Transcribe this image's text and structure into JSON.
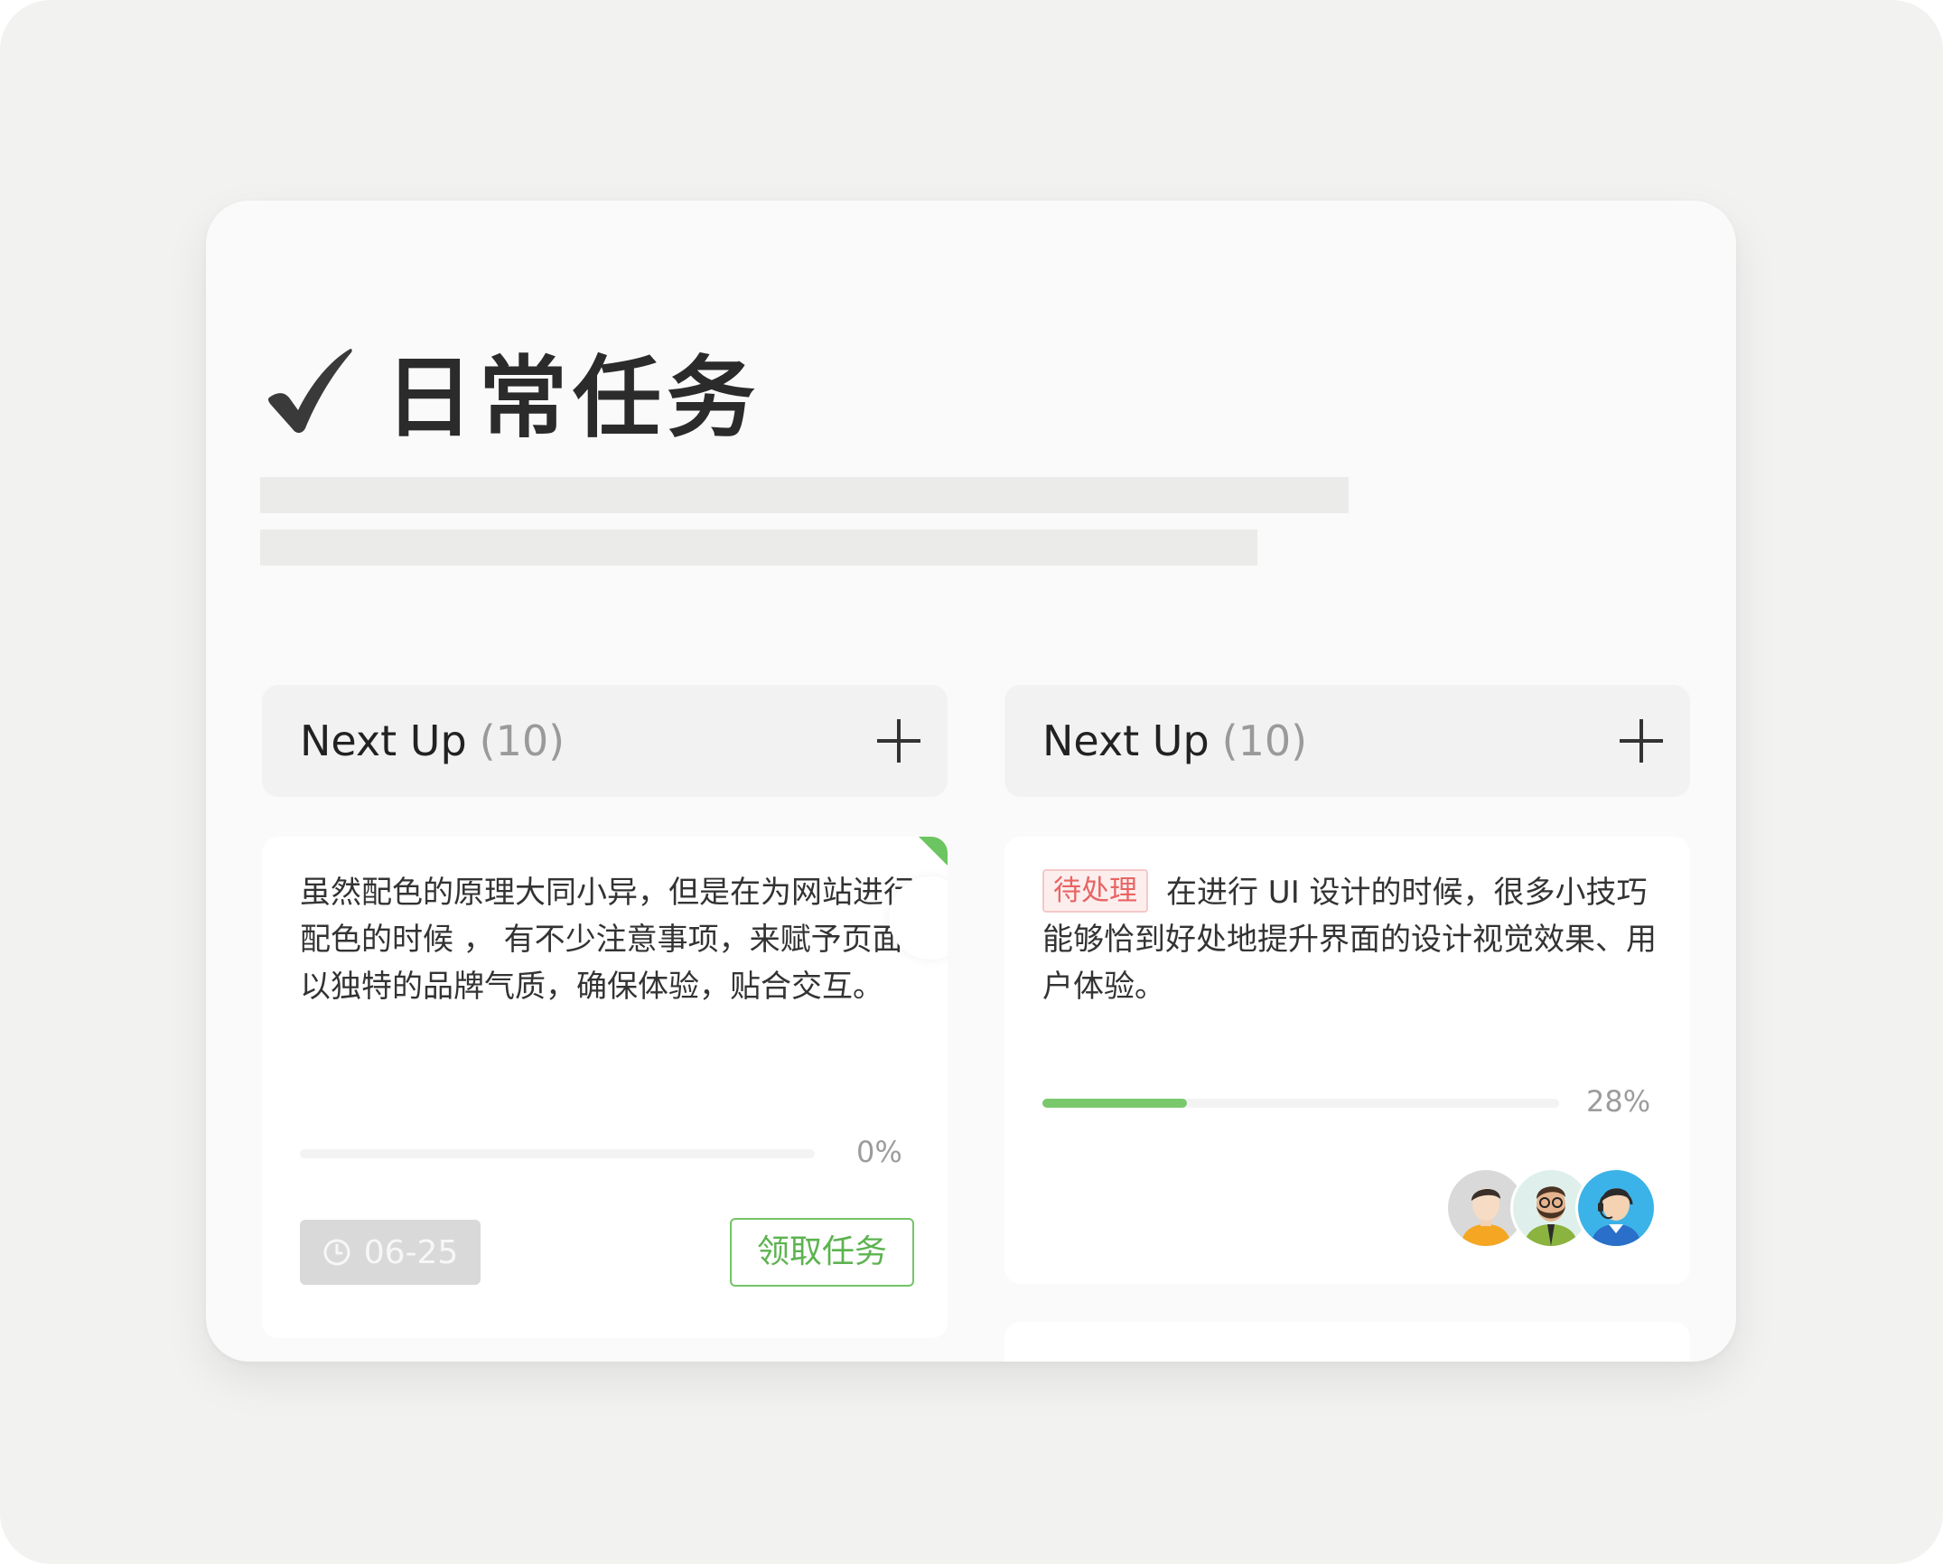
{
  "page": {
    "title": "日常任务",
    "title_icon": "checkmark-icon"
  },
  "columns": [
    {
      "title": "Next Up",
      "count": "(10)",
      "add_icon": "plus-icon",
      "card": {
        "text": "虽然配色的原理大同小异，但是在为网站进行配色的时候 ， 有不少注意事项，来赋予页面以独特的品牌气质，确保体验，贴合交互。",
        "progress_percent": 0,
        "progress_label": "0%",
        "due_date": "06-25",
        "due_icon": "clock-icon",
        "action_label": "领取任务",
        "flag_color": "#6cc560"
      }
    },
    {
      "title": "Next Up",
      "count": "(10)",
      "add_icon": "plus-icon",
      "card": {
        "tag": "待处理",
        "text": "在进行 UI 设计的时候，很多小技巧能够恰到好处地提升界面的设计视觉效果、用户体验。",
        "progress_percent": 28,
        "progress_label": "28%",
        "avatars": [
          "avatar-man-orange-icon",
          "avatar-man-beard-glasses-icon",
          "avatar-man-headset-icon"
        ]
      }
    }
  ],
  "colors": {
    "accent_green": "#79c96c",
    "tag_red": "#e86464",
    "background": "#f2f2f1"
  }
}
